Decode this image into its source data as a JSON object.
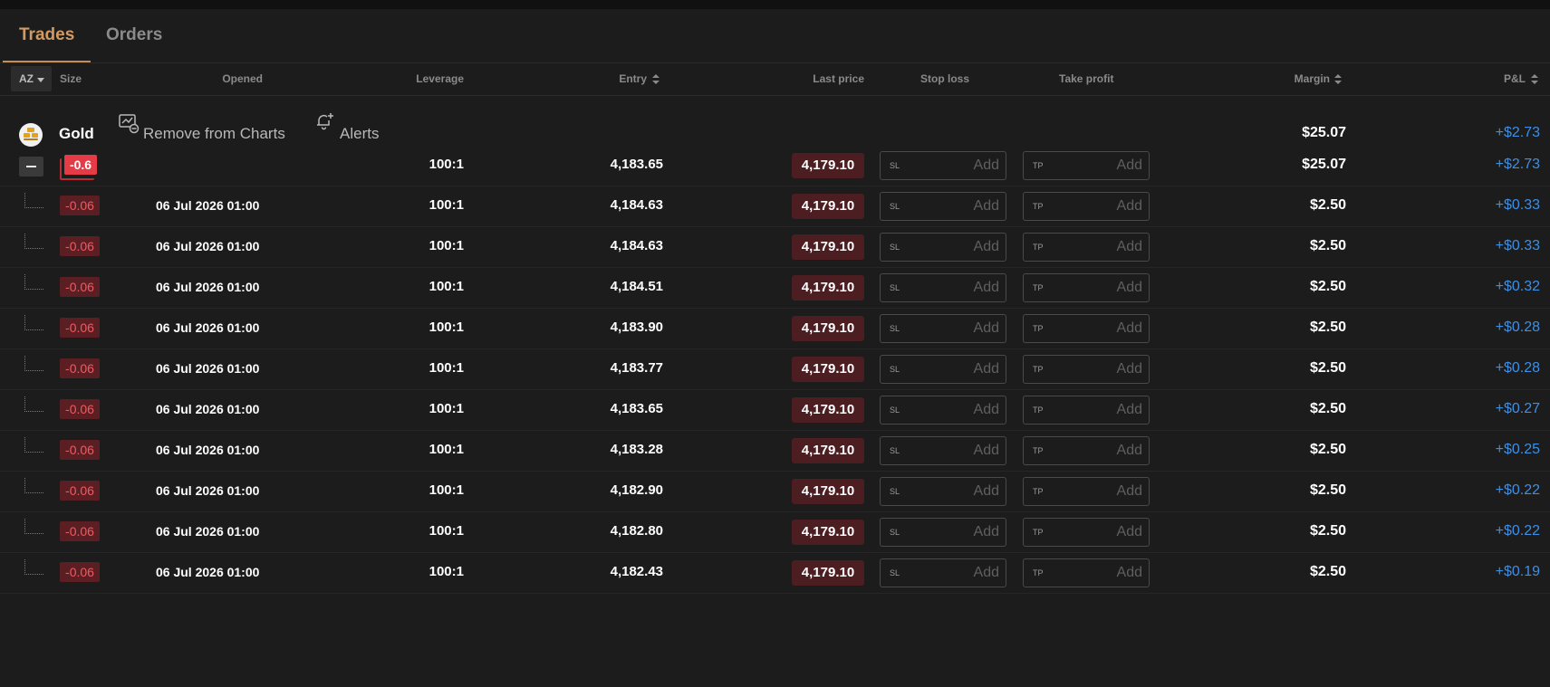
{
  "tabs": [
    {
      "label": "Trades",
      "active": true
    },
    {
      "label": "Orders",
      "active": false
    }
  ],
  "header": {
    "sort": "AZ",
    "size": "Size",
    "opened": "Opened",
    "leverage": "Leverage",
    "entry": "Entry",
    "last_price": "Last price",
    "stop_loss": "Stop loss",
    "take_profit": "Take profit",
    "margin": "Margin",
    "pnl": "P&L"
  },
  "group": {
    "name": "Gold",
    "remove_label": "Remove from Charts",
    "alerts_label": "Alerts",
    "margin": "$25.07",
    "pnl": "+$2.73"
  },
  "summary": {
    "size": "-0.6",
    "leverage": "100:1",
    "entry": "4,183.65",
    "last_price": "4,179.10",
    "sl_tag": "SL",
    "tp_tag": "TP",
    "add_label": "Add",
    "margin": "$25.07",
    "pnl": "+$2.73"
  },
  "positions": [
    {
      "size": "-0.06",
      "opened": "06 Jul 2026 01:00",
      "leverage": "100:1",
      "entry": "4,184.63",
      "last_price": "4,179.10",
      "sl_tag": "SL",
      "tp_tag": "TP",
      "add_label": "Add",
      "margin": "$2.50",
      "pnl": "+$0.33"
    },
    {
      "size": "-0.06",
      "opened": "06 Jul 2026 01:00",
      "leverage": "100:1",
      "entry": "4,184.63",
      "last_price": "4,179.10",
      "sl_tag": "SL",
      "tp_tag": "TP",
      "add_label": "Add",
      "margin": "$2.50",
      "pnl": "+$0.33"
    },
    {
      "size": "-0.06",
      "opened": "06 Jul 2026 01:00",
      "leverage": "100:1",
      "entry": "4,184.51",
      "last_price": "4,179.10",
      "sl_tag": "SL",
      "tp_tag": "TP",
      "add_label": "Add",
      "margin": "$2.50",
      "pnl": "+$0.32"
    },
    {
      "size": "-0.06",
      "opened": "06 Jul 2026 01:00",
      "leverage": "100:1",
      "entry": "4,183.90",
      "last_price": "4,179.10",
      "sl_tag": "SL",
      "tp_tag": "TP",
      "add_label": "Add",
      "margin": "$2.50",
      "pnl": "+$0.28"
    },
    {
      "size": "-0.06",
      "opened": "06 Jul 2026 01:00",
      "leverage": "100:1",
      "entry": "4,183.77",
      "last_price": "4,179.10",
      "sl_tag": "SL",
      "tp_tag": "TP",
      "add_label": "Add",
      "margin": "$2.50",
      "pnl": "+$0.28"
    },
    {
      "size": "-0.06",
      "opened": "06 Jul 2026 01:00",
      "leverage": "100:1",
      "entry": "4,183.65",
      "last_price": "4,179.10",
      "sl_tag": "SL",
      "tp_tag": "TP",
      "add_label": "Add",
      "margin": "$2.50",
      "pnl": "+$0.27"
    },
    {
      "size": "-0.06",
      "opened": "06 Jul 2026 01:00",
      "leverage": "100:1",
      "entry": "4,183.28",
      "last_price": "4,179.10",
      "sl_tag": "SL",
      "tp_tag": "TP",
      "add_label": "Add",
      "margin": "$2.50",
      "pnl": "+$0.25"
    },
    {
      "size": "-0.06",
      "opened": "06 Jul 2026 01:00",
      "leverage": "100:1",
      "entry": "4,182.90",
      "last_price": "4,179.10",
      "sl_tag": "SL",
      "tp_tag": "TP",
      "add_label": "Add",
      "margin": "$2.50",
      "pnl": "+$0.22"
    },
    {
      "size": "-0.06",
      "opened": "06 Jul 2026 01:00",
      "leverage": "100:1",
      "entry": "4,182.80",
      "last_price": "4,179.10",
      "sl_tag": "SL",
      "tp_tag": "TP",
      "add_label": "Add",
      "margin": "$2.50",
      "pnl": "+$0.22"
    },
    {
      "size": "-0.06",
      "opened": "06 Jul 2026 01:00",
      "leverage": "100:1",
      "entry": "4,182.43",
      "last_price": "4,179.10",
      "sl_tag": "SL",
      "tp_tag": "TP",
      "add_label": "Add",
      "margin": "$2.50",
      "pnl": "+$0.19"
    }
  ],
  "colors": {
    "accent": "#d29a63",
    "negative": "#ef5a62",
    "positive": "#3d8fe6"
  },
  "icons": {
    "gold": "gold-bars-icon",
    "remove_from_charts": "chart-remove-icon",
    "alerts": "bell-plus-icon",
    "collapse": "minus-icon"
  }
}
